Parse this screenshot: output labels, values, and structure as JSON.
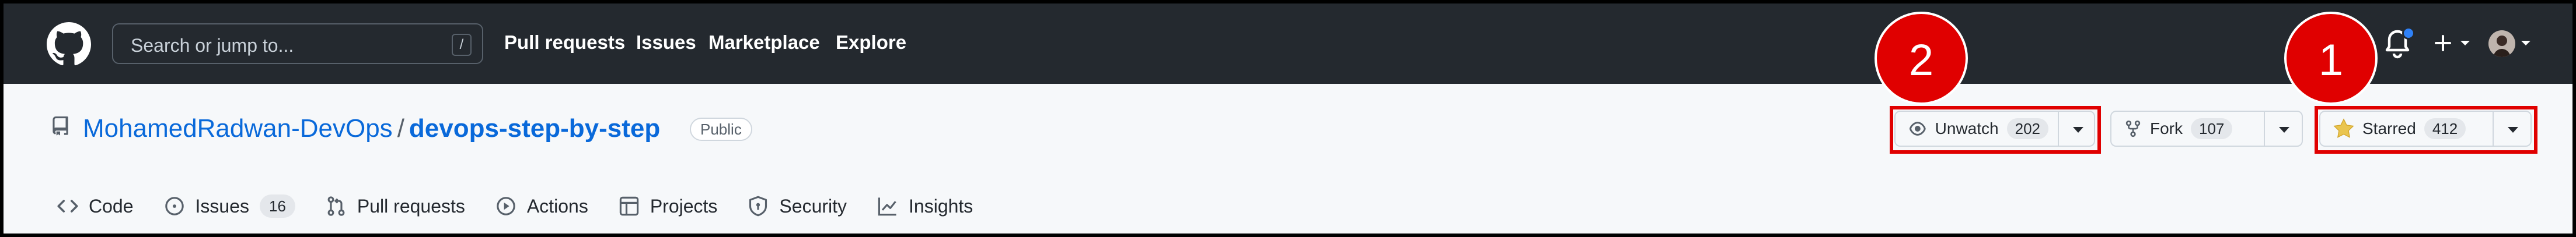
{
  "header": {
    "search_placeholder": "Search or jump to...",
    "search_shortcut": "/",
    "nav": [
      "Pull requests",
      "Issues",
      "Marketplace",
      "Explore"
    ]
  },
  "repo": {
    "owner": "MohamedRadwan-DevOps",
    "separator": "/",
    "name": "devops-step-by-step",
    "visibility": "Public"
  },
  "actions": {
    "watch": {
      "label": "Unwatch",
      "count": "202"
    },
    "fork": {
      "label": "Fork",
      "count": "107"
    },
    "star": {
      "label": "Starred",
      "count": "412"
    }
  },
  "callouts": {
    "one": "1",
    "two": "2"
  },
  "tabs": [
    {
      "label": "Code",
      "icon": "code-icon"
    },
    {
      "label": "Issues",
      "icon": "issue-icon",
      "count": "16"
    },
    {
      "label": "Pull requests",
      "icon": "pull-request-icon"
    },
    {
      "label": "Actions",
      "icon": "play-icon"
    },
    {
      "label": "Projects",
      "icon": "table-icon"
    },
    {
      "label": "Security",
      "icon": "shield-icon"
    },
    {
      "label": "Insights",
      "icon": "graph-icon"
    }
  ],
  "colors": {
    "header_bg": "#24292f",
    "link": "#0969da",
    "highlight": "#e00000",
    "star": "#eac54f",
    "tab_underline": "#fd8c73"
  }
}
